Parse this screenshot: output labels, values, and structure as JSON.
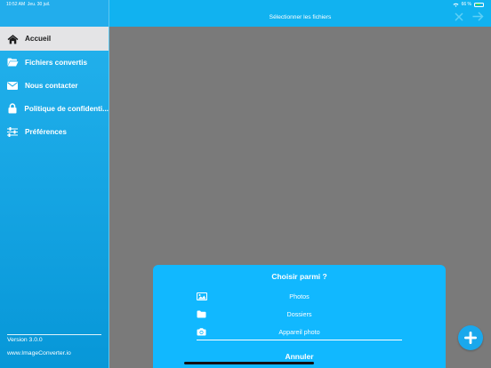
{
  "status": {
    "time": "10:52 AM",
    "date": "Jeu. 30 juil.",
    "battery": "66 %",
    "battery_level_pct": 66
  },
  "colors": {
    "sidebar": "#0fa7e6",
    "topbar": "#11b2f0",
    "sheet": "#11b8ff",
    "active_bg": "#e4e4e6",
    "overlay": "#7a7a7a"
  },
  "sidebar": {
    "items": [
      {
        "label": "Accueil",
        "icon": "home-icon",
        "active": true
      },
      {
        "label": "Fichiers convertis",
        "icon": "folder-open-icon"
      },
      {
        "label": "Nous contacter",
        "icon": "envelope-icon"
      },
      {
        "label": "Politique de confidenti...",
        "icon": "lock-icon"
      },
      {
        "label": "Préférences",
        "icon": "sliders-icon"
      }
    ],
    "version": "Version 3.0.0",
    "website": "www.ImageConverter.io"
  },
  "topbar": {
    "title": "Sélectionner les fichiers"
  },
  "sheet": {
    "title": "Choisir parmi ?",
    "options": [
      {
        "label": "Photos",
        "icon": "image-icon"
      },
      {
        "label": "Dossiers",
        "icon": "folder-icon"
      },
      {
        "label": "Appareil photo",
        "icon": "camera-icon"
      }
    ],
    "cancel": "Annuler"
  }
}
